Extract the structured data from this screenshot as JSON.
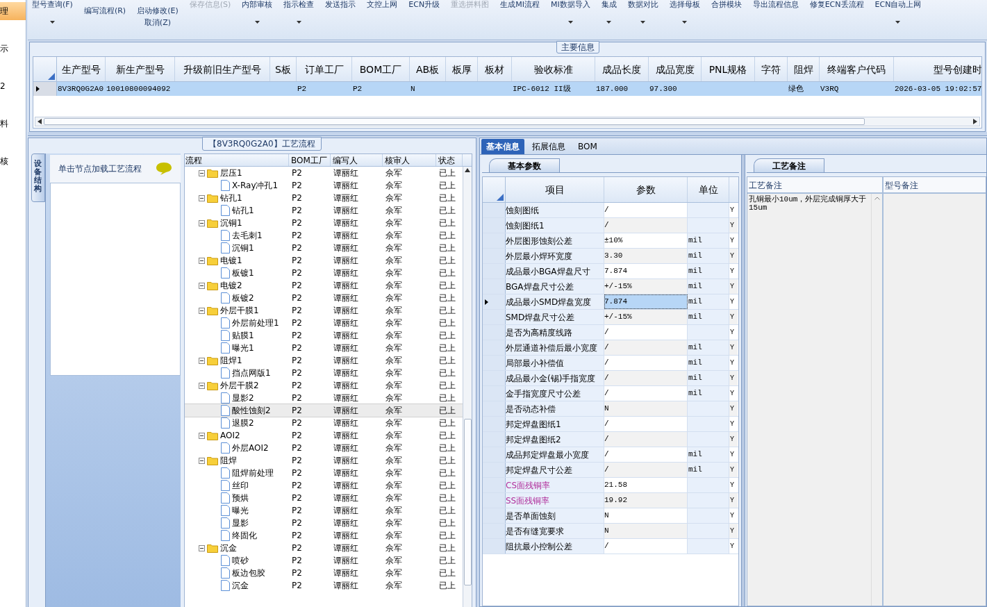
{
  "side_nav": [
    {
      "label": "理",
      "selected": true
    },
    {
      "label": "示",
      "selected": false
    },
    {
      "label": "2",
      "selected": false
    },
    {
      "label": "料",
      "selected": false
    },
    {
      "label": "核",
      "selected": false
    }
  ],
  "toolbar": [
    {
      "kind": "top",
      "label": "型号查询(F)",
      "disabled": false,
      "dropdown": true
    },
    {
      "kind": "stacked",
      "label": "编写流程(R)",
      "disabled": false,
      "dropdown": false
    },
    {
      "kind": "stacked",
      "label": "启动修改(E)",
      "sublabel": "取消(Z)",
      "disabled": false,
      "dropdown": false
    },
    {
      "kind": "top",
      "label": "保存信息(S)",
      "disabled": true,
      "dropdown": false
    },
    {
      "kind": "top",
      "label": "内部审核",
      "disabled": false,
      "dropdown": true
    },
    {
      "kind": "top",
      "label": "指示检查",
      "disabled": false,
      "dropdown": true
    },
    {
      "kind": "top",
      "label": "发送指示",
      "disabled": false,
      "dropdown": false
    },
    {
      "kind": "top",
      "label": "文控上网",
      "disabled": false,
      "dropdown": false
    },
    {
      "kind": "top",
      "label": "ECN升级",
      "disabled": false,
      "dropdown": false
    },
    {
      "kind": "top",
      "label": "重选拼料图",
      "disabled": true,
      "dropdown": false
    },
    {
      "kind": "top",
      "label": "生成MI流程",
      "disabled": false,
      "dropdown": false
    },
    {
      "kind": "top",
      "label": "MI数据导入",
      "disabled": false,
      "dropdown": true
    },
    {
      "kind": "top",
      "label": "集成",
      "disabled": false,
      "dropdown": true
    },
    {
      "kind": "top",
      "label": "数据对比",
      "disabled": false,
      "dropdown": true
    },
    {
      "kind": "top",
      "label": "选择母板",
      "disabled": false,
      "dropdown": true
    },
    {
      "kind": "top",
      "label": "合拼模块",
      "disabled": false,
      "dropdown": false
    },
    {
      "kind": "top",
      "label": "导出流程信息",
      "disabled": false,
      "dropdown": false
    },
    {
      "kind": "top",
      "label": "修复ECN丢流程",
      "disabled": false,
      "dropdown": false
    },
    {
      "kind": "top",
      "label": "ECN自动上网",
      "disabled": false,
      "dropdown": true
    }
  ],
  "main_info": {
    "title": "主要信息",
    "columns": [
      "生产型号",
      "新生产型号",
      "升级前旧生产型号",
      "S板",
      "订单工厂",
      "BOM工厂",
      "AB板",
      "板厚",
      "板材",
      "验收标准",
      "成品长度",
      "成品宽度",
      "PNL规格",
      "字符",
      "阻焊",
      "终端客户代码",
      "型号创建时"
    ],
    "rows": [
      {
        "selected": true,
        "cells": [
          "8V3RQ0G2A0",
          "10010800094092",
          null,
          null,
          "P2",
          "P2",
          "N",
          null,
          null,
          "IPC-6012 II级",
          "187.000",
          "97.300",
          null,
          null,
          "绿色",
          "V3RQ",
          "2026-03-05 19:02:57"
        ]
      }
    ]
  },
  "flow_panel": {
    "title": "【8V3RQ0G2A0】工艺流程",
    "side_tab": "设备结构",
    "hint": "单击节点加载工艺流程",
    "columns": [
      "流程",
      "BOM工厂",
      "编写人",
      "核审人",
      "状态"
    ],
    "tree": [
      {
        "name": "层压1",
        "bom": "P2",
        "writer": "谭丽红",
        "reviewer": "佘军",
        "status": "已上",
        "selected": false,
        "expanded": true,
        "children": [
          {
            "name": "X-Ray冲孔1",
            "bom": "P2",
            "writer": "谭丽红",
            "reviewer": "佘军",
            "status": "已上",
            "selected": false
          }
        ]
      },
      {
        "name": "钻孔1",
        "bom": "P2",
        "writer": "谭丽红",
        "reviewer": "佘军",
        "status": "已上",
        "selected": false,
        "expanded": true,
        "children": [
          {
            "name": "钻孔1",
            "bom": "P2",
            "writer": "谭丽红",
            "reviewer": "佘军",
            "status": "已上",
            "selected": false
          }
        ]
      },
      {
        "name": "沉铜1",
        "bom": "P2",
        "writer": "谭丽红",
        "reviewer": "佘军",
        "status": "已上",
        "selected": false,
        "expanded": true,
        "children": [
          {
            "name": "去毛刺1",
            "bom": "P2",
            "writer": "谭丽红",
            "reviewer": "佘军",
            "status": "已上",
            "selected": false
          },
          {
            "name": "沉铜1",
            "bom": "P2",
            "writer": "谭丽红",
            "reviewer": "佘军",
            "status": "已上",
            "selected": false
          }
        ]
      },
      {
        "name": "电镀1",
        "bom": "P2",
        "writer": "谭丽红",
        "reviewer": "佘军",
        "status": "已上",
        "selected": false,
        "expanded": true,
        "children": [
          {
            "name": "板镀1",
            "bom": "P2",
            "writer": "谭丽红",
            "reviewer": "佘军",
            "status": "已上",
            "selected": false
          }
        ]
      },
      {
        "name": "电镀2",
        "bom": "P2",
        "writer": "谭丽红",
        "reviewer": "佘军",
        "status": "已上",
        "selected": false,
        "expanded": true,
        "children": [
          {
            "name": "板镀2",
            "bom": "P2",
            "writer": "谭丽红",
            "reviewer": "佘军",
            "status": "已上",
            "selected": false
          }
        ]
      },
      {
        "name": "外层干膜1",
        "bom": "P2",
        "writer": "谭丽红",
        "reviewer": "佘军",
        "status": "已上",
        "selected": false,
        "expanded": true,
        "children": [
          {
            "name": "外层前处理1",
            "bom": "P2",
            "writer": "谭丽红",
            "reviewer": "佘军",
            "status": "已上",
            "selected": false
          },
          {
            "name": "贴膜1",
            "bom": "P2",
            "writer": "谭丽红",
            "reviewer": "佘军",
            "status": "已上",
            "selected": false
          },
          {
            "name": "曝光1",
            "bom": "P2",
            "writer": "谭丽红",
            "reviewer": "佘军",
            "status": "已上",
            "selected": false
          }
        ]
      },
      {
        "name": "阻焊1",
        "bom": "P2",
        "writer": "谭丽红",
        "reviewer": "佘军",
        "status": "已上",
        "selected": false,
        "expanded": true,
        "children": [
          {
            "name": "挡点网版1",
            "bom": "P2",
            "writer": "谭丽红",
            "reviewer": "佘军",
            "status": "已上",
            "selected": false
          }
        ]
      },
      {
        "name": "外层干膜2",
        "bom": "P2",
        "writer": "谭丽红",
        "reviewer": "佘军",
        "status": "已上",
        "selected": false,
        "expanded": true,
        "children": [
          {
            "name": "显影2",
            "bom": "P2",
            "writer": "谭丽红",
            "reviewer": "佘军",
            "status": "已上",
            "selected": false
          },
          {
            "name": "酸性蚀刻2",
            "bom": "P2",
            "writer": "谭丽红",
            "reviewer": "佘军",
            "status": "已上",
            "selected": true
          },
          {
            "name": "退膜2",
            "bom": "P2",
            "writer": "谭丽红",
            "reviewer": "佘军",
            "status": "已上",
            "selected": false
          }
        ]
      },
      {
        "name": "AOI2",
        "bom": "P2",
        "writer": "谭丽红",
        "reviewer": "佘军",
        "status": "已上",
        "selected": false,
        "expanded": true,
        "children": [
          {
            "name": "外层AOI2",
            "bom": "P2",
            "writer": "谭丽红",
            "reviewer": "佘军",
            "status": "已上",
            "selected": false
          }
        ]
      },
      {
        "name": "阻焊",
        "bom": "P2",
        "writer": "谭丽红",
        "reviewer": "佘军",
        "status": "已上",
        "selected": false,
        "expanded": true,
        "children": [
          {
            "name": "阻焊前处理",
            "bom": "P2",
            "writer": "谭丽红",
            "reviewer": "佘军",
            "status": "已上",
            "selected": false
          },
          {
            "name": "丝印",
            "bom": "P2",
            "writer": "谭丽红",
            "reviewer": "佘军",
            "status": "已上",
            "selected": false
          },
          {
            "name": "预烘",
            "bom": "P2",
            "writer": "谭丽红",
            "reviewer": "佘军",
            "status": "已上",
            "selected": false
          },
          {
            "name": "曝光",
            "bom": "P2",
            "writer": "谭丽红",
            "reviewer": "佘军",
            "status": "已上",
            "selected": false
          },
          {
            "name": "显影",
            "bom": "P2",
            "writer": "谭丽红",
            "reviewer": "佘军",
            "status": "已上",
            "selected": false
          },
          {
            "name": "终固化",
            "bom": "P2",
            "writer": "谭丽红",
            "reviewer": "佘军",
            "status": "已上",
            "selected": false
          }
        ]
      },
      {
        "name": "沉金",
        "bom": "P2",
        "writer": "谭丽红",
        "reviewer": "佘军",
        "status": "已上",
        "selected": false,
        "expanded": true,
        "children": [
          {
            "name": "喷砂",
            "bom": "P2",
            "writer": "谭丽红",
            "reviewer": "佘军",
            "status": "已上",
            "selected": false
          },
          {
            "name": "板边包胶",
            "bom": "P2",
            "writer": "谭丽红",
            "reviewer": "佘军",
            "status": "已上",
            "selected": false
          },
          {
            "name": "沉金",
            "bom": "P2",
            "writer": "谭丽红",
            "reviewer": "佘军",
            "status": "已上",
            "selected": false
          }
        ]
      }
    ]
  },
  "detail_tabs": [
    {
      "label": "基本信息",
      "selected": true
    },
    {
      "label": "拓展信息",
      "selected": false
    },
    {
      "label": "BOM",
      "selected": false
    }
  ],
  "basic_params": {
    "tab": "基本参数",
    "columns": [
      "项目",
      "参数",
      "单位"
    ],
    "rows": [
      {
        "item": "蚀刻图纸",
        "value": "/",
        "flag": "Y",
        "selected": false
      },
      {
        "item": "蚀刻图纸1",
        "value": "/",
        "flag": "Y",
        "selected": false
      },
      {
        "item": "外层图形蚀刻公差",
        "value": "±10%",
        "unit": "mil",
        "flag": "Y",
        "selected": false
      },
      {
        "item": "外层最小焊环宽度",
        "value": "3.30",
        "unit": "mil",
        "flag": "Y",
        "selected": false
      },
      {
        "item": "成品最小BGA焊盘尺寸",
        "value": "7.874",
        "unit": "mil",
        "flag": "Y",
        "selected": false
      },
      {
        "item": "BGA焊盘尺寸公差",
        "value": "+/-15%",
        "unit": "mil",
        "flag": "Y",
        "selected": false
      },
      {
        "item": "成品最小SMD焊盘宽度",
        "value": "7.874",
        "unit": "mil",
        "flag": "Y",
        "selected": true
      },
      {
        "item": "SMD焊盘尺寸公差",
        "value": "+/-15%",
        "unit": "mil",
        "flag": "Y",
        "selected": false
      },
      {
        "item": "是否为高精度线路",
        "value": "/",
        "flag": "Y",
        "selected": false
      },
      {
        "item": "外层通道补偿后最小宽度",
        "value": "/",
        "unit": "mil",
        "flag": "Y",
        "selected": false
      },
      {
        "item": "局部最小补偿值",
        "value": "/",
        "unit": "mil",
        "flag": "Y",
        "selected": false
      },
      {
        "item": "成品最小金(锡)手指宽度",
        "value": "/",
        "unit": "mil",
        "flag": "Y",
        "selected": false
      },
      {
        "item": "金手指宽度尺寸公差",
        "value": "/",
        "unit": "mil",
        "flag": "Y",
        "selected": false
      },
      {
        "item": "是否动态补偿",
        "value": "N",
        "flag": "Y",
        "selected": false
      },
      {
        "item": "邦定焊盘图纸1",
        "value": "/",
        "flag": "Y",
        "selected": false
      },
      {
        "item": "邦定焊盘图纸2",
        "value": "/",
        "flag": "Y",
        "selected": false
      },
      {
        "item": "成品邦定焊盘最小宽度",
        "value": "/",
        "unit": "mil",
        "flag": "Y",
        "selected": false
      },
      {
        "item": "邦定焊盘尺寸公差",
        "value": "/",
        "unit": "mil",
        "flag": "Y",
        "selected": false
      },
      {
        "item": "CS面残铜率",
        "value": "21.58",
        "flag": "Y",
        "selected": false,
        "color": "#b0309c"
      },
      {
        "item": "SS面残铜率",
        "value": "19.92",
        "flag": "Y",
        "selected": false,
        "color": "#b0309c"
      },
      {
        "item": "是否单面蚀刻",
        "value": "N",
        "flag": "Y",
        "selected": false
      },
      {
        "item": "是否有缝宽要求",
        "value": "N",
        "flag": "Y",
        "selected": false
      },
      {
        "item": "阻抗最小控制公差",
        "value": "/",
        "flag": "Y",
        "selected": false
      }
    ]
  },
  "process_notes": {
    "tab": "工艺备注",
    "columns": [
      "工艺备注",
      "型号备注"
    ],
    "note": "孔铜最小10um，外层完成铜厚大于15um"
  }
}
